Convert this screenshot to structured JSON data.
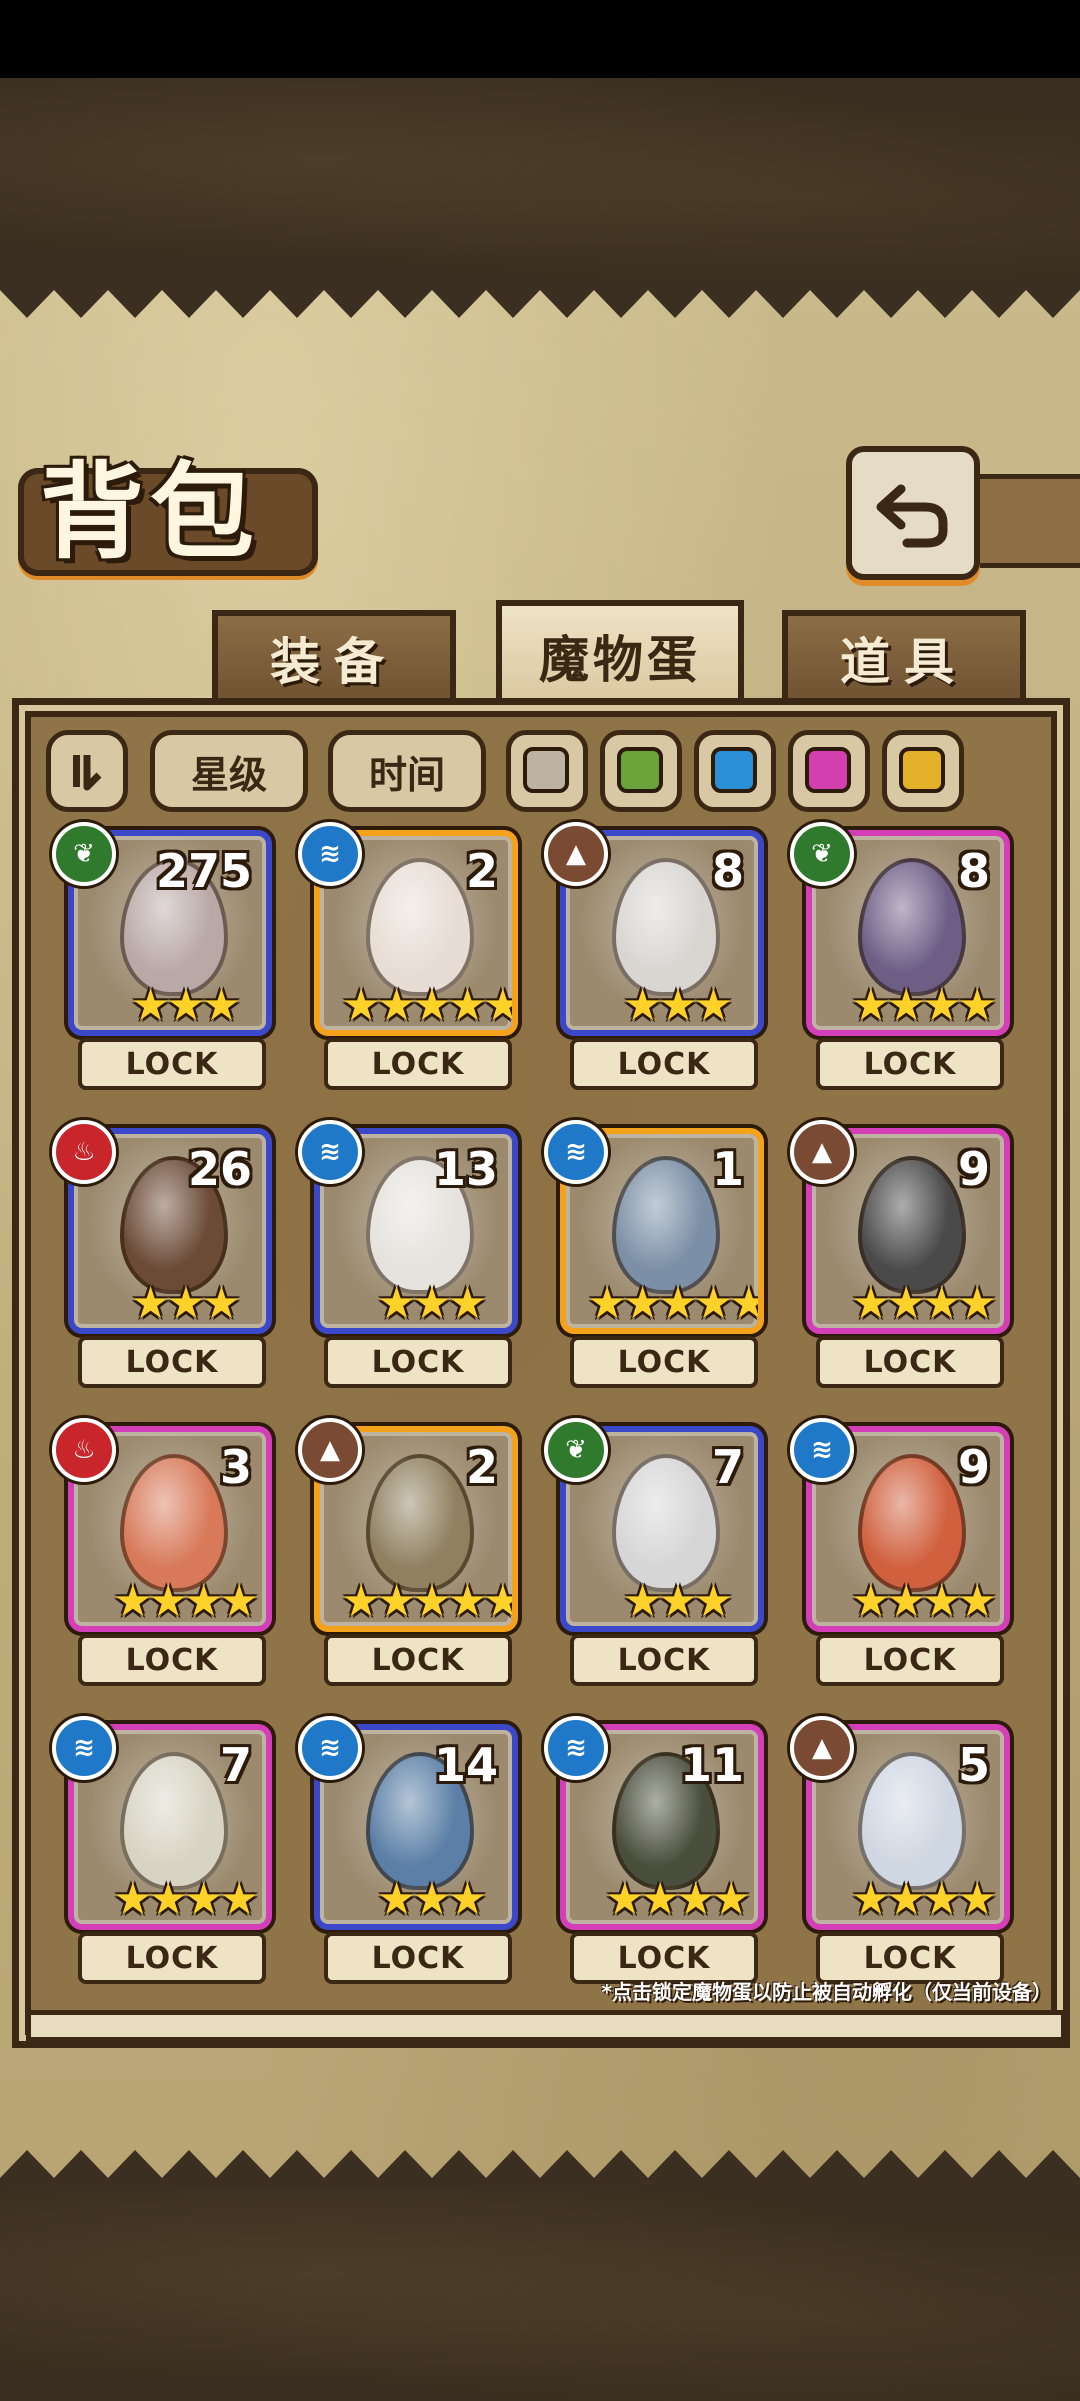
{
  "header": {
    "title": "背包"
  },
  "tabs": [
    {
      "label": "装备",
      "active": false
    },
    {
      "label": "魔物蛋",
      "active": true
    },
    {
      "label": "道具",
      "active": false
    }
  ],
  "filters": {
    "sort_icon": "sort-icon",
    "star_label": "星级",
    "time_label": "时间",
    "swatches": [
      "#bdb3a0",
      "#6aa33a",
      "#2a8fd6",
      "#d23fae",
      "#e3b02a"
    ]
  },
  "eggs": [
    {
      "element": "grass",
      "count": "275",
      "stars": "★★★",
      "lock": "LOCK",
      "rarity": "blue",
      "egg_color": "#b9a9a6"
    },
    {
      "element": "water",
      "count": "2",
      "stars": "★★★★★",
      "lock": "LOCK",
      "rarity": "gold",
      "egg_color": "#e7ddd4"
    },
    {
      "element": "earth",
      "count": "8",
      "stars": "★★★",
      "lock": "LOCK",
      "rarity": "blue",
      "egg_color": "#d9d6d2"
    },
    {
      "element": "grass",
      "count": "8",
      "stars": "★★★★",
      "lock": "LOCK",
      "rarity": "pink",
      "egg_color": "#6e5e86"
    },
    {
      "element": "fire",
      "count": "26",
      "stars": "★★★",
      "lock": "LOCK",
      "rarity": "blue",
      "egg_color": "#6b4a36"
    },
    {
      "element": "water",
      "count": "13",
      "stars": "★★★",
      "lock": "LOCK",
      "rarity": "blue",
      "egg_color": "#e6e2dd"
    },
    {
      "element": "water",
      "count": "1",
      "stars": "★★★★★",
      "lock": "LOCK",
      "rarity": "gold",
      "egg_color": "#7b8fa6"
    },
    {
      "element": "earth",
      "count": "9",
      "stars": "★★★★",
      "lock": "LOCK",
      "rarity": "pink",
      "egg_color": "#4a4a4a"
    },
    {
      "element": "fire",
      "count": "3",
      "stars": "★★★★",
      "lock": "LOCK",
      "rarity": "pink",
      "egg_color": "#d87a5a"
    },
    {
      "element": "earth",
      "count": "2",
      "stars": "★★★★★",
      "lock": "LOCK",
      "rarity": "gold",
      "egg_color": "#8f8060"
    },
    {
      "element": "grass",
      "count": "7",
      "stars": "★★★",
      "lock": "LOCK",
      "rarity": "blue",
      "egg_color": "#d6d6d6"
    },
    {
      "element": "water",
      "count": "9",
      "stars": "★★★★",
      "lock": "LOCK",
      "rarity": "pink",
      "egg_color": "#d0603e"
    },
    {
      "element": "water",
      "count": "7",
      "stars": "★★★★",
      "lock": "LOCK",
      "rarity": "pink",
      "egg_color": "#d8d4c4"
    },
    {
      "element": "water",
      "count": "14",
      "stars": "★★★",
      "lock": "LOCK",
      "rarity": "blue",
      "egg_color": "#5b7fa6"
    },
    {
      "element": "water",
      "count": "11",
      "stars": "★★★★",
      "lock": "LOCK",
      "rarity": "pink",
      "egg_color": "#4a4e3c"
    },
    {
      "element": "earth",
      "count": "5",
      "stars": "★★★★",
      "lock": "LOCK",
      "rarity": "pink",
      "egg_color": "#cfd7e2"
    }
  ],
  "footer_note": "*点击锁定魔物蛋以防止被自动孵化（仅当前设备）"
}
